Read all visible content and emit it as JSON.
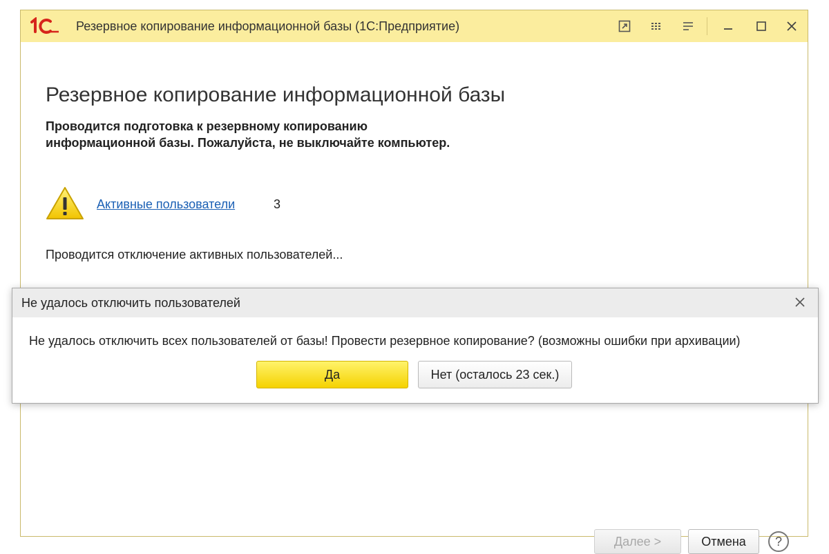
{
  "window": {
    "title": "Резервное копирование информационной базы  (1С:Предприятие)",
    "logo_text": "1С"
  },
  "main": {
    "heading": "Резервное копирование информационной базы",
    "notice_line1": "Проводится подготовка к резервному копированию",
    "notice_line2": "информационной базы. Пожалуйста, не выключайте компьютер.",
    "active_users_link": "Активные пользователи",
    "active_users_count": "3",
    "status": "Проводится отключение активных пользователей..."
  },
  "footer": {
    "next_label": "Далее >",
    "cancel_label": "Отмена",
    "help_label": "?"
  },
  "dialog": {
    "title": "Не удалось отключить пользователей",
    "message": "Не удалось отключить всех пользователей от базы! Провести резервное копирование? (возможны ошибки при архивации)",
    "yes_label": "Да",
    "no_label": "Нет (осталось 23 сек.)"
  },
  "colors": {
    "titlebar_bg": "#fbed9e",
    "link": "#1a5fb4",
    "yes_button": "#f5d200",
    "logo_red": "#d6251b"
  },
  "icons": {
    "logo": "1c-logo-icon",
    "link_window": "link-window-icon",
    "menu_dots": "more-actions-icon",
    "hamburger": "menu-icon",
    "minimize": "minimize-icon",
    "maximize": "maximize-icon",
    "close": "close-icon",
    "warning": "warning-icon"
  }
}
